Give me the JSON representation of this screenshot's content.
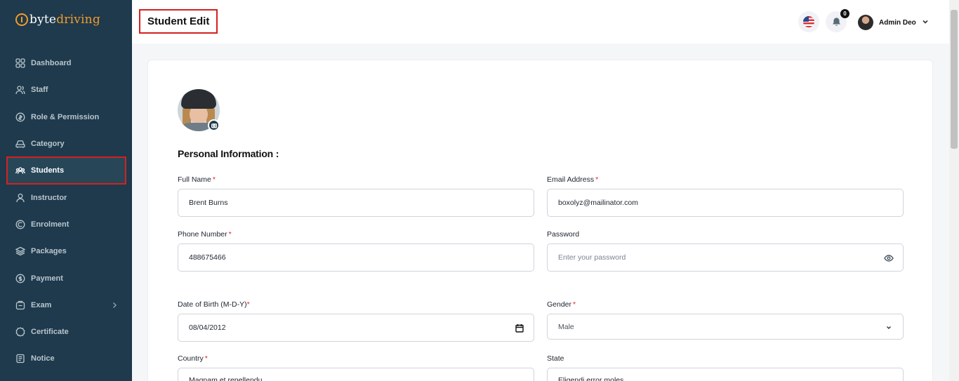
{
  "brand": {
    "part1": "byte",
    "part2": "driving"
  },
  "sidebar": {
    "items": [
      {
        "label": "Dashboard",
        "icon": "dashboard-icon"
      },
      {
        "label": "Staff",
        "icon": "users-icon"
      },
      {
        "label": "Role & Permission",
        "icon": "shield-icon"
      },
      {
        "label": "Category",
        "icon": "car-icon"
      },
      {
        "label": "Students",
        "icon": "students-icon"
      },
      {
        "label": "Instructor",
        "icon": "user-icon"
      },
      {
        "label": "Enrolment",
        "icon": "enrolment-icon"
      },
      {
        "label": "Packages",
        "icon": "layers-icon"
      },
      {
        "label": "Payment",
        "icon": "dollar-icon"
      },
      {
        "label": "Exam",
        "icon": "exam-icon"
      },
      {
        "label": "Certificate",
        "icon": "certificate-icon"
      },
      {
        "label": "Notice",
        "icon": "notice-icon"
      }
    ],
    "active": "Students"
  },
  "header": {
    "title": "Student Edit",
    "notification_count": "0",
    "user_name": "Admin Deo"
  },
  "form": {
    "section_title": "Personal Information :",
    "full_name": {
      "label": "Full Name",
      "value": "Brent Burns"
    },
    "email": {
      "label": "Email Address",
      "value": "boxolyz@mailinator.com"
    },
    "phone": {
      "label": "Phone Number",
      "value": "488675466"
    },
    "password": {
      "label": "Password",
      "placeholder": "Enter your password"
    },
    "dob": {
      "label": "Date of Birth (M-D-Y)",
      "value": "08/04/2012"
    },
    "gender": {
      "label": "Gender",
      "value": "Male"
    },
    "country": {
      "label": "Country",
      "value": "Magnam et repellendu"
    },
    "state": {
      "label": "State",
      "value": "Eligendi error moles"
    },
    "required_mark": "*"
  },
  "colors": {
    "sidebar_bg": "#1e3a4c",
    "brand_accent": "#f39a2b",
    "highlight_box": "#d62020",
    "required": "#e02424"
  }
}
